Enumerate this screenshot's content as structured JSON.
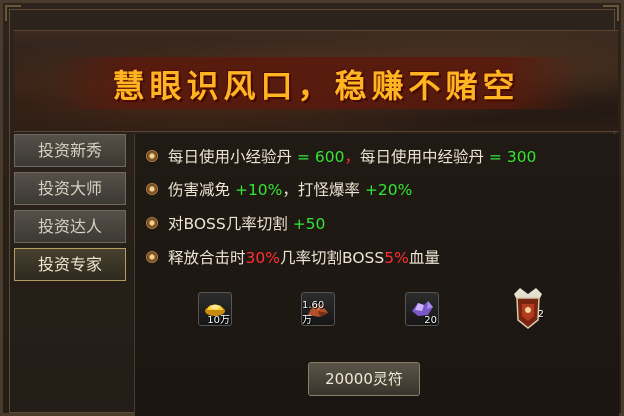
{
  "banner": {
    "title": "慧眼识风口，稳赚不赌空"
  },
  "tabs": [
    {
      "label": "投资新秀"
    },
    {
      "label": "投资大师"
    },
    {
      "label": "投资达人"
    },
    {
      "label": "投资专家",
      "active": true
    }
  ],
  "benefits": {
    "line1": {
      "a": "每日使用小经验丹",
      "b": "= 600",
      "c": "，",
      "d": "每日使用中经验丹",
      "e": "= 300"
    },
    "line2": {
      "a": "伤害减免",
      "b": "+10%",
      "c": "，",
      "d": "打怪爆率",
      "e": "+20%"
    },
    "line3": {
      "a": "对BOSS几率切割",
      "b": "+50"
    },
    "line4": {
      "a": "释放合击时",
      "b": "30%",
      "c": "几率切割BOSS",
      "d": "5%",
      "e": "血量"
    }
  },
  "rewards": [
    {
      "icon": "gold-ingot-icon",
      "count": "10万"
    },
    {
      "icon": "ore-pile-icon",
      "count": "1.60万"
    },
    {
      "icon": "purple-crystal-icon",
      "count": "20"
    },
    {
      "icon": "crest-medal-icon",
      "count": "2"
    }
  ],
  "buy_button": {
    "label": "20000灵符"
  },
  "colors": {
    "title": "#ffb422",
    "positive": "#33e633",
    "highlight": "#ff3030"
  }
}
